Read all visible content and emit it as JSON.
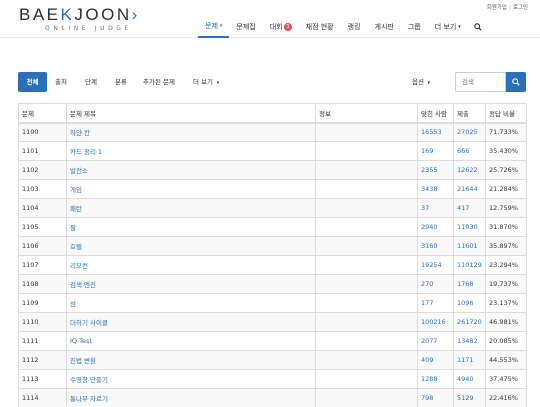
{
  "logo": {
    "main_pre": "BAE",
    "main_k": "K",
    "main_post": "JOON",
    "arrow": "›",
    "sub": "ONLINE JUDGE"
  },
  "account": {
    "signup": "회원가입",
    "login": "로그인"
  },
  "nav": {
    "problems": "문제",
    "workbook": "문제집",
    "contest": "대회",
    "contest_badge": "3",
    "status": "채점 현황",
    "ranking": "랭킹",
    "board": "게시판",
    "group": "그룹",
    "more": "더 보기"
  },
  "toolbar": {
    "tabs": [
      "전체",
      "출처",
      "단계",
      "분류",
      "추가된 문제",
      "더 보기"
    ],
    "options": "옵션",
    "search_placeholder": "검색"
  },
  "table": {
    "headers": [
      "문제",
      "문제 제목",
      "정보",
      "맞힌 사람",
      "제출",
      "정답 비율"
    ],
    "rows": [
      {
        "id": "1100",
        "title": "하얀 칸",
        "info": "",
        "solved": "16553",
        "submit": "27025",
        "ratio": "71.733%"
      },
      {
        "id": "1101",
        "title": "카드 정리 1",
        "info": "",
        "solved": "169",
        "submit": "666",
        "ratio": "35.430%"
      },
      {
        "id": "1102",
        "title": "발전소",
        "info": "",
        "solved": "2355",
        "submit": "12622",
        "ratio": "25.726%"
      },
      {
        "id": "1103",
        "title": "게임",
        "info": "",
        "solved": "3438",
        "submit": "21644",
        "ratio": "21.284%"
      },
      {
        "id": "1104",
        "title": "패턴",
        "info": "",
        "solved": "37",
        "submit": "417",
        "ratio": "12.759%"
      },
      {
        "id": "1105",
        "title": "팔",
        "info": "",
        "solved": "2940",
        "submit": "11030",
        "ratio": "31.870%"
      },
      {
        "id": "1106",
        "title": "호텔",
        "info": "",
        "solved": "3160",
        "submit": "11601",
        "ratio": "35.897%"
      },
      {
        "id": "1107",
        "title": "리모컨",
        "info": "",
        "solved": "19254",
        "submit": "110129",
        "ratio": "23.294%"
      },
      {
        "id": "1108",
        "title": "검색 엔진",
        "info": "",
        "solved": "270",
        "submit": "1768",
        "ratio": "19.737%"
      },
      {
        "id": "1109",
        "title": "섬",
        "info": "",
        "solved": "177",
        "submit": "1096",
        "ratio": "23.137%"
      },
      {
        "id": "1110",
        "title": "더하기 사이클",
        "info": "",
        "solved": "100216",
        "submit": "261720",
        "ratio": "46.981%"
      },
      {
        "id": "1111",
        "title": "IQ Test",
        "info": "",
        "solved": "2077",
        "submit": "13482",
        "ratio": "20.085%"
      },
      {
        "id": "1112",
        "title": "진법 변환",
        "info": "",
        "solved": "409",
        "submit": "1171",
        "ratio": "44.553%"
      },
      {
        "id": "1113",
        "title": "수영장 만들기",
        "info": "",
        "solved": "1288",
        "submit": "4940",
        "ratio": "37.475%"
      },
      {
        "id": "1114",
        "title": "통나무 자르기",
        "info": "",
        "solved": "798",
        "submit": "5129",
        "ratio": "22.416%"
      }
    ]
  },
  "colors": {
    "accent": "#2a6fb8",
    "badge": "#d9534f"
  }
}
